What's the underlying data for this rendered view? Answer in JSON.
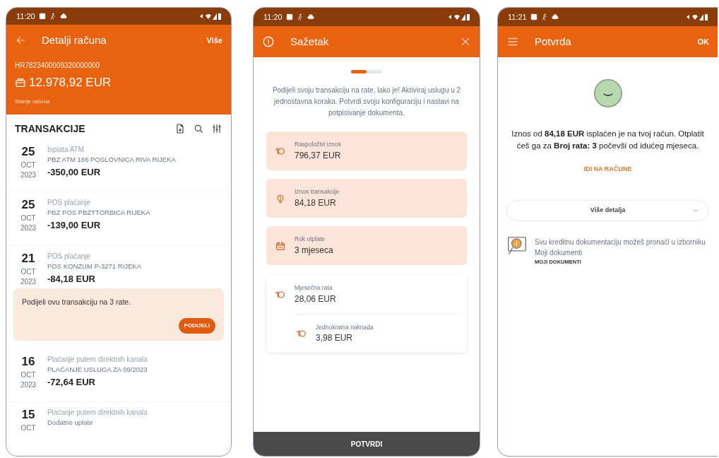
{
  "phones": [
    {
      "kind": "account",
      "status_time": "11:20",
      "header": {
        "title": "Detalji računa",
        "action": "Više"
      },
      "account": {
        "iban": "HR7823400009320000000",
        "balance": "12.978,92 EUR",
        "balance_label": "Stanje računa"
      },
      "section_title": "TRANSAKCIJE",
      "transactions": [
        {
          "day": "25",
          "month": "OCT",
          "year": "2023",
          "type": "Isplata ATM",
          "description": "PBZ ATM 186 POSLOVNICA RIVA RIJEKA",
          "amount": "-350,00 EUR"
        },
        {
          "day": "25",
          "month": "OCT",
          "year": "2023",
          "type": "POS plaćanje",
          "description": "PBZ POS PBZTTORBICA RIJEKA",
          "amount": "-139,00 EUR"
        },
        {
          "day": "21",
          "month": "OCT",
          "year": "2023",
          "type": "POS plaćanje",
          "description": "POS KONZUM P-3271 RIJEKA",
          "amount": "-84,18 EUR",
          "offer": {
            "text": "Podijeli ovu transakciju na 3 rate.",
            "button": "PODIJELI"
          }
        },
        {
          "day": "16",
          "month": "OCT",
          "year": "2023",
          "type": "Plaćanje putem direktnih kanala",
          "description": "PLAĆANJE USLUGA ZA 09/2023",
          "amount": "-72,64 EUR"
        },
        {
          "day": "15",
          "month": "OCT",
          "type": "Plaćanje putem direktnih kanala",
          "description": "Dodatne uplate"
        }
      ]
    },
    {
      "kind": "summary",
      "status_time": "11:20",
      "header": {
        "title": "Sažetak"
      },
      "steps": [
        {
          "selected": true
        },
        {
          "selected": false
        }
      ],
      "intro": "Podijeli svoju transakciju na rate, lako je! Aktiviraj uslugu u 2 jednostavna koraka. Potvrdi svoju konfiguraciju i nastavi na potpisivanje dokumenta.",
      "cards": [
        {
          "kind": "highlight",
          "items": [
            {
              "label": "Raspoloživi iznos",
              "value": "796,37 EUR"
            }
          ]
        },
        {
          "kind": "highlight",
          "items": [
            {
              "label": "Iznos transakcije",
              "value": "84,18 EUR"
            }
          ]
        },
        {
          "kind": "highlight",
          "items": [
            {
              "label": "Rok otplate",
              "value": "3 mjeseca"
            }
          ]
        },
        {
          "kind": "plain",
          "items": [
            {
              "label": "Mjesečna rata",
              "value": "28,06 EUR"
            },
            {
              "label": "Jednokratna naknada",
              "value": "3,98 EUR"
            }
          ]
        }
      ],
      "button": "POTVRDI"
    },
    {
      "kind": "confirmation",
      "status_time": "11:21",
      "header": {
        "title": "Potvrda",
        "action": "OK"
      },
      "message": "Iznos od **84,18 EUR** isplaćen je na tvoj račun. Otplatit ćeš ga za **Broj rata: 3** počevši od idućeg mjeseca.",
      "link": "IDI NA RAČUNE",
      "details": {
        "label": "Više detalja",
        "expanded": false
      },
      "note": {
        "text": "Svu kreditnu dokumentaciju možeš pronaći u izborniku Moji dokumenti",
        "link": "MOJI DOKUMENTI"
      }
    }
  ]
}
